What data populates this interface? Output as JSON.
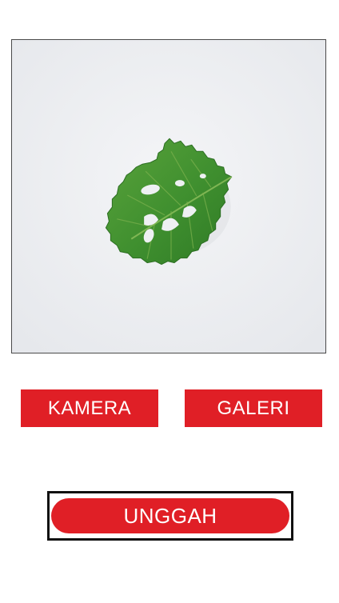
{
  "colors": {
    "accent": "#e01f26",
    "preview_background": "#eef0f3",
    "leaf": "#3f8f2f"
  },
  "preview": {
    "content": "leaf-image"
  },
  "buttons": {
    "camera_label": "KAMERA",
    "gallery_label": "GALERI",
    "upload_label": "UNGGAH"
  }
}
